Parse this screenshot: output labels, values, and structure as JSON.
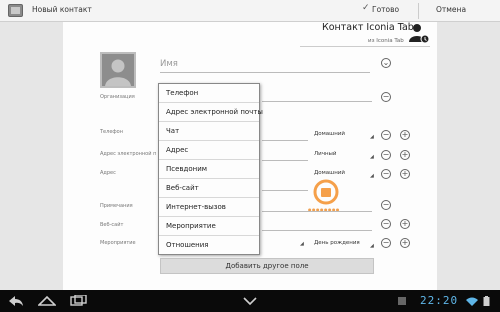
{
  "action_bar": {
    "title": "Новый контакт",
    "done_label": "Готово",
    "cancel_label": "Отмена"
  },
  "account": {
    "title": "Контакт Iconia Tab",
    "subtitle": "из Iconia Tab"
  },
  "fields": {
    "name_placeholder": "Имя",
    "labels": {
      "organization": "Организация",
      "phone": "Телефон",
      "email": "Адрес электронной п",
      "address": "Адрес",
      "notes": "Примечания",
      "website": "Веб-сайт",
      "event": "Мероприятие"
    },
    "types": {
      "phone": "Домашний",
      "email": "Личный",
      "address": "Домашний",
      "event": "День рождения"
    }
  },
  "menu": {
    "items": [
      "Телефон",
      "Адрес электронной почты",
      "Чат",
      "Адрес",
      "Псевдоним",
      "Веб-сайт",
      "Интернет-вызов",
      "Мероприятие",
      "Отношения"
    ]
  },
  "add_field_label": "Добавить другое поле",
  "system_bar": {
    "clock": "22:20"
  }
}
